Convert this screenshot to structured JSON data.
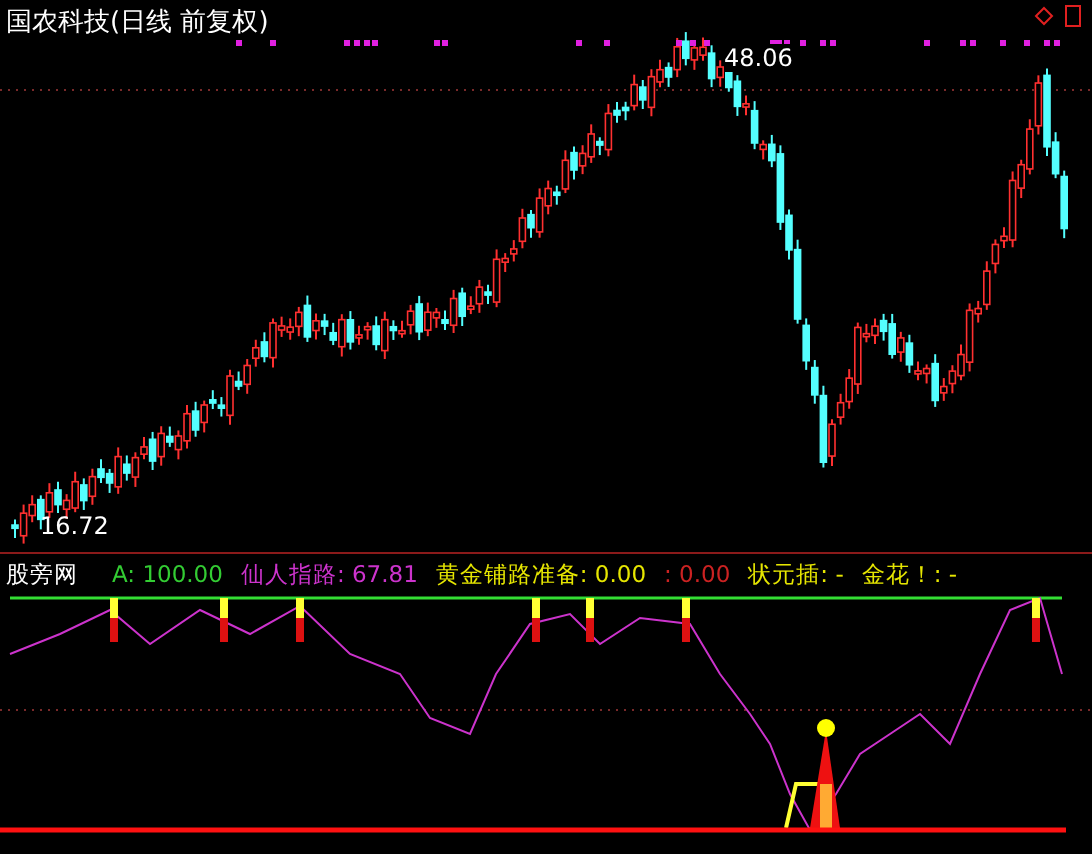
{
  "price_panel": {
    "title": "国农科技(日线 前复权)",
    "high_label": "48.06",
    "low_label": "16.72"
  },
  "indicator_panel": {
    "name": "股旁网",
    "legend": [
      {
        "label": "A: 100.00",
        "color": "#33cc33"
      },
      {
        "label": "仙人指路: 67.81",
        "color": "#cc33cc"
      },
      {
        "label": "黄金铺路准备: 0.00",
        "color": "#e6e600"
      },
      {
        "label": ": 0.00",
        "color": "#cc2222"
      },
      {
        "label": "状元插: -",
        "color": "#e6e600"
      },
      {
        "label": "金花！: -",
        "color": "#e6e600"
      }
    ]
  }
}
